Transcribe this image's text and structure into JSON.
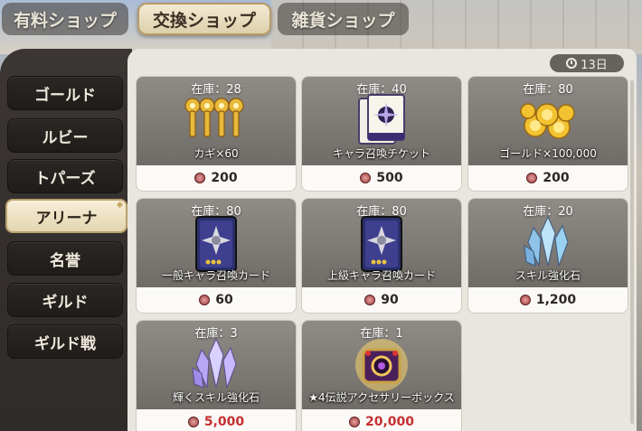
{
  "shop_tabs": [
    "有料ショップ",
    "交換ショップ",
    "雑貨ショップ"
  ],
  "active_shop_tab": "交換ショップ",
  "categories": [
    "ゴールド",
    "ルビー",
    "トパーズ",
    "アリーナ",
    "名誉",
    "ギルド",
    "ギルド戦"
  ],
  "active_category": "アリーナ",
  "days_left": "13日",
  "items": [
    {
      "stock": "在庫：28",
      "name": "カギ×60",
      "price": "200"
    },
    {
      "stock": "在庫：40",
      "name": "キャラ召喚チケット",
      "price": "500"
    },
    {
      "stock": "在庫：80",
      "name": "ゴールド×100,000",
      "price": "200"
    },
    {
      "stock": "在庫：80",
      "name": "一般キャラ召喚カード",
      "price": "60"
    },
    {
      "stock": "在庫：80",
      "name": "上級キャラ召喚カード",
      "price": "90"
    },
    {
      "stock": "在庫：20",
      "name": "スキル強化石",
      "price": "1,200"
    },
    {
      "stock": "在庫：3",
      "name": "輝くスキル強化石",
      "price": "5,000"
    },
    {
      "stock": "在庫：1",
      "name": "★4伝説アクセサリーボックス",
      "price": "20,000"
    }
  ],
  "icons": [
    "clock-icon",
    "keys-icon",
    "ticket-icon",
    "coins-icon",
    "summon-card-icon",
    "crystal-icon",
    "accessory-box-icon",
    "medal-icon"
  ],
  "colors": {
    "accent": "#b9a06d",
    "price_red": "#c62f2f"
  }
}
